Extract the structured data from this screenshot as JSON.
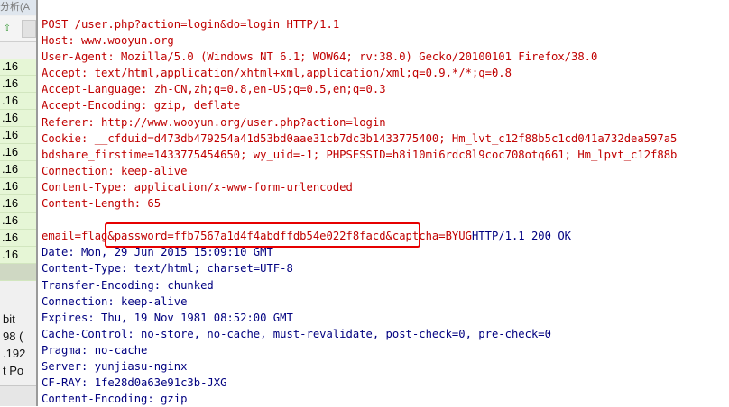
{
  "background_window": {
    "title": "分析(A",
    "toolbar_icon": "green-arrow-icon",
    "packet_times": [
      ".16",
      ".16",
      ".16",
      ".16",
      ".16",
      ".16",
      ".16",
      ".16",
      ".16",
      ".16",
      ".16",
      ".16",
      ""
    ],
    "detail_lines": [
      " bit",
      "98 (",
      ".192",
      "t Po"
    ]
  },
  "stream": {
    "request_lines": [
      "POST /user.php?action=login&do=login HTTP/1.1",
      "Host: www.wooyun.org",
      "User-Agent: Mozilla/5.0 (Windows NT 6.1; WOW64; rv:38.0) Gecko/20100101 Firefox/38.0",
      "Accept: text/html,application/xhtml+xml,application/xml;q=0.9,*/*;q=0.8",
      "Accept-Language: zh-CN,zh;q=0.8,en-US;q=0.5,en;q=0.3",
      "Accept-Encoding: gzip, deflate",
      "Referer: http://www.wooyun.org/user.php?action=login",
      "Cookie: __cfduid=d473db479254a41d53bd0aae31cb7dc3b1433775400; Hm_lvt_c12f88b5c1cd041a732dea597a5",
      "bdshare_firstime=1433775454650; wy_uid=-1; PHPSESSID=h8i10mi6rdc8l9coc708otq661; Hm_lpvt_c12f88b",
      "Connection: keep-alive",
      "Content-Type: application/x-www-form-urlencoded",
      "Content-Length: 65"
    ],
    "body_request": "email=flag&password=ffb7567a1d4f4abdffdb54e022f8facd&captcha=BYUG",
    "body_response": "HTTP/1.1 200 OK",
    "response_lines": [
      "Date: Mon, 29 Jun 2015 15:09:10 GMT",
      "Content-Type: text/html; charset=UTF-8",
      "Transfer-Encoding: chunked",
      "Connection: keep-alive",
      "Expires: Thu, 19 Nov 1981 08:52:00 GMT",
      "Cache-Control: no-store, no-cache, must-revalidate, post-check=0, pre-check=0",
      "Pragma: no-cache",
      "Server: yunjiasu-nginx",
      "CF-RAY: 1fe28d0a63e91c3b-JXG",
      "Content-Encoding: gzip"
    ]
  },
  "colors": {
    "request": "#c00000",
    "response": "#000080",
    "highlight": "#e60000"
  }
}
